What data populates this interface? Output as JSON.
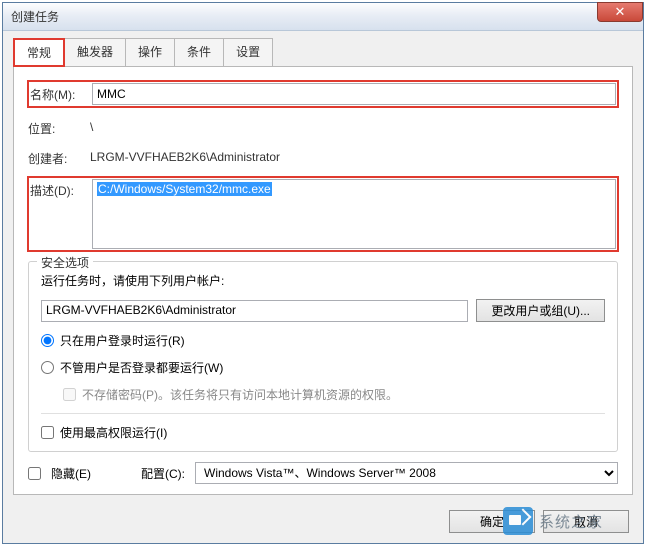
{
  "window": {
    "title": "创建任务"
  },
  "tabs": {
    "items": [
      {
        "label": "常规"
      },
      {
        "label": "触发器"
      },
      {
        "label": "操作"
      },
      {
        "label": "条件"
      },
      {
        "label": "设置"
      }
    ]
  },
  "general": {
    "name_label": "名称(M):",
    "name_value": "MMC",
    "location_label": "位置:",
    "location_value": "\\",
    "author_label": "创建者:",
    "author_value": "LRGM-VVFHAEB2K6\\Administrator",
    "desc_label": "描述(D):",
    "desc_value": "C:/Windows/System32/mmc.exe"
  },
  "security": {
    "group_title": "安全选项",
    "run_as_label": "运行任务时，请使用下列用户帐户:",
    "account_value": "LRGM-VVFHAEB2K6\\Administrator",
    "change_user_btn": "更改用户或组(U)...",
    "radio_logged_on": "只在用户登录时运行(R)",
    "radio_any": "不管用户是否登录都要运行(W)",
    "no_store_pw": "不存储密码(P)。该任务将只有访问本地计算机资源的权限。",
    "highest_priv": "使用最高权限运行(I)"
  },
  "bottom": {
    "hidden_label": "隐藏(E)",
    "config_label": "配置(C):",
    "config_value": "Windows Vista™、Windows Server™ 2008"
  },
  "buttons": {
    "ok": "确定",
    "cancel": "取消"
  },
  "watermark": "系统之家"
}
